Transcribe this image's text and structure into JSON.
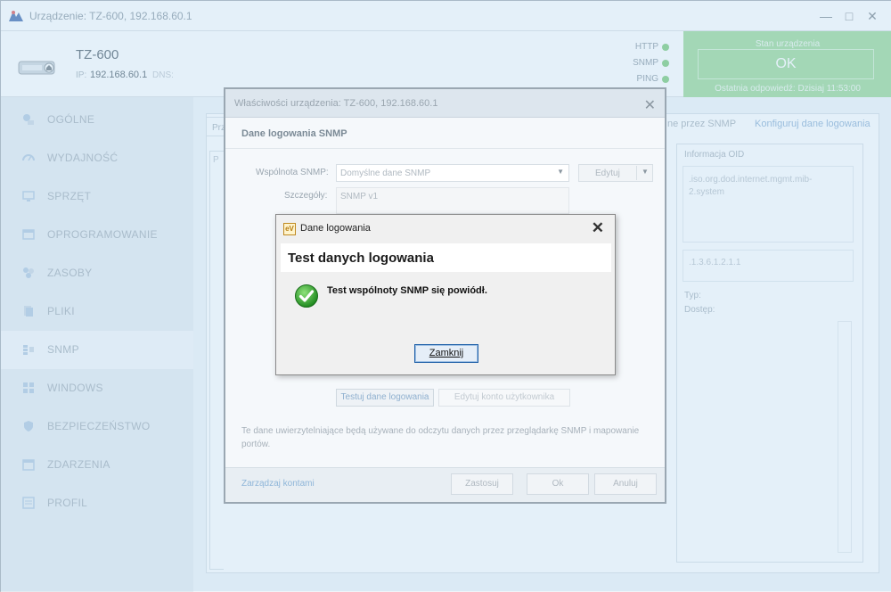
{
  "window": {
    "title": "Urządzenie: TZ-600, 192.168.60.1",
    "minimize_icon": "minimize-icon",
    "maximize_icon": "maximize-icon",
    "close_icon": "close-icon"
  },
  "device": {
    "name": "TZ-600",
    "ip_label": "IP:",
    "ip": "192.168.60.1",
    "dns_label": "DNS:",
    "icon": "router-icon"
  },
  "protocols": [
    {
      "name": "HTTP",
      "status_color": "#6cc46a"
    },
    {
      "name": "SNMP",
      "status_color": "#6cc46a"
    },
    {
      "name": "PING",
      "status_color": "#6cc46a"
    }
  ],
  "status": {
    "label": "Stan urządzenia",
    "value": "OK",
    "last_response": "Ostatnia odpowiedź: Dzisiaj 11:53:00",
    "color": "#8fd48c"
  },
  "sidebar": {
    "items": [
      {
        "label": "OGÓLNE",
        "icon": "general-icon"
      },
      {
        "label": "WYDAJNOŚĆ",
        "icon": "performance-icon"
      },
      {
        "label": "SPRZĘT",
        "icon": "hardware-icon"
      },
      {
        "label": "OPROGRAMOWANIE",
        "icon": "software-icon"
      },
      {
        "label": "ZASOBY",
        "icon": "resources-icon"
      },
      {
        "label": "PLIKI",
        "icon": "files-icon"
      },
      {
        "label": "SNMP",
        "icon": "snmp-icon"
      },
      {
        "label": "WINDOWS",
        "icon": "windows-icon"
      },
      {
        "label": "BEZPIECZEŃSTWO",
        "icon": "security-icon"
      },
      {
        "label": "ZDARZENIA",
        "icon": "events-icon"
      },
      {
        "label": "PROFIL",
        "icon": "profile-icon"
      }
    ],
    "active_index": 6
  },
  "main": {
    "tab_stub": "Prz",
    "left_col_stub": "P",
    "link_manage": "ne przez SNMP",
    "link_configure": "Konfiguruj dane logowania",
    "oid": {
      "title": "Informacja OID",
      "path": ".iso.org.dod.internet.mgmt.mib-2.system",
      "numeric": ".1.3.6.1.2.1.1",
      "type_label": "Typ:",
      "access_label": "Dostęp:"
    }
  },
  "properties_dialog": {
    "title": "Właściwości urządzenia: TZ-600, 192.168.60.1",
    "section": "Dane logowania SNMP",
    "community_label": "Wspólnota SNMP:",
    "community_value": "Domyślne dane SNMP",
    "edit_button": "Edytuj",
    "details_label": "Szczegóły:",
    "details_value": "SNMP v1",
    "test_button": "Testuj dane logowania",
    "edit_account_button": "Edytuj konto użytkownika",
    "note": "Te dane uwierzytelniające będą używane do odczytu danych przez przeglądarkę SNMP i mapowanie portów.",
    "manage_accounts_link": "Zarządzaj kontami",
    "apply_button": "Zastosuj",
    "ok_button": "Ok",
    "cancel_button": "Anuluj"
  },
  "credential_dialog": {
    "title": "Dane logowania",
    "logo_text": "eV",
    "heading": "Test danych logowania",
    "message": "Test wspólnoty SNMP się powiódł.",
    "close_button": "Zamknij",
    "success_icon": "success-check-icon"
  }
}
